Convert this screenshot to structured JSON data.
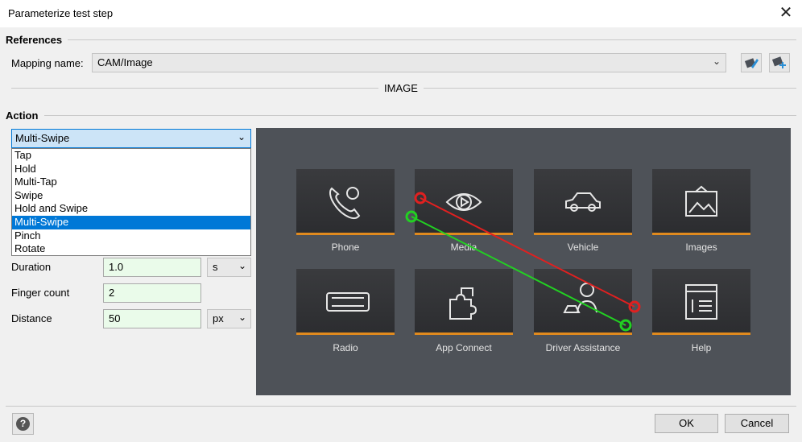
{
  "window": {
    "title": "Parameterize test step",
    "close_symbol": "✕"
  },
  "references": {
    "heading": "References",
    "mapping_label": "Mapping name:",
    "mapping_value": "CAM/Image",
    "divider_label": "IMAGE"
  },
  "action": {
    "heading": "Action",
    "selected": "Multi-Swipe",
    "options": [
      "Tap",
      "Hold",
      "Multi-Tap",
      "Swipe",
      "Hold and Swipe",
      "Multi-Swipe",
      "Pinch",
      "Rotate"
    ],
    "selected_index": 5
  },
  "params": {
    "duration_label": "Duration",
    "duration_value": "1.0",
    "duration_unit": "s",
    "finger_count_label": "Finger count",
    "finger_count_value": "2",
    "distance_label": "Distance",
    "distance_value": "50",
    "distance_unit": "px"
  },
  "preview": {
    "tiles": [
      {
        "label": "Phone",
        "icon": "phone-icon"
      },
      {
        "label": "Media",
        "icon": "eye-play-icon"
      },
      {
        "label": "Vehicle",
        "icon": "car-icon"
      },
      {
        "label": "Images",
        "icon": "picture-icon"
      },
      {
        "label": "Radio",
        "icon": "radio-icon"
      },
      {
        "label": "App Connect",
        "icon": "puzzle-icon"
      },
      {
        "label": "Driver Assistance",
        "icon": "driver-icon"
      },
      {
        "label": "Help",
        "icon": "help-document-icon"
      }
    ],
    "swipe_colors": {
      "first": "#e02020",
      "second": "#22d022"
    }
  },
  "footer": {
    "ok_label": "OK",
    "cancel_label": "Cancel",
    "help_symbol": "?"
  }
}
